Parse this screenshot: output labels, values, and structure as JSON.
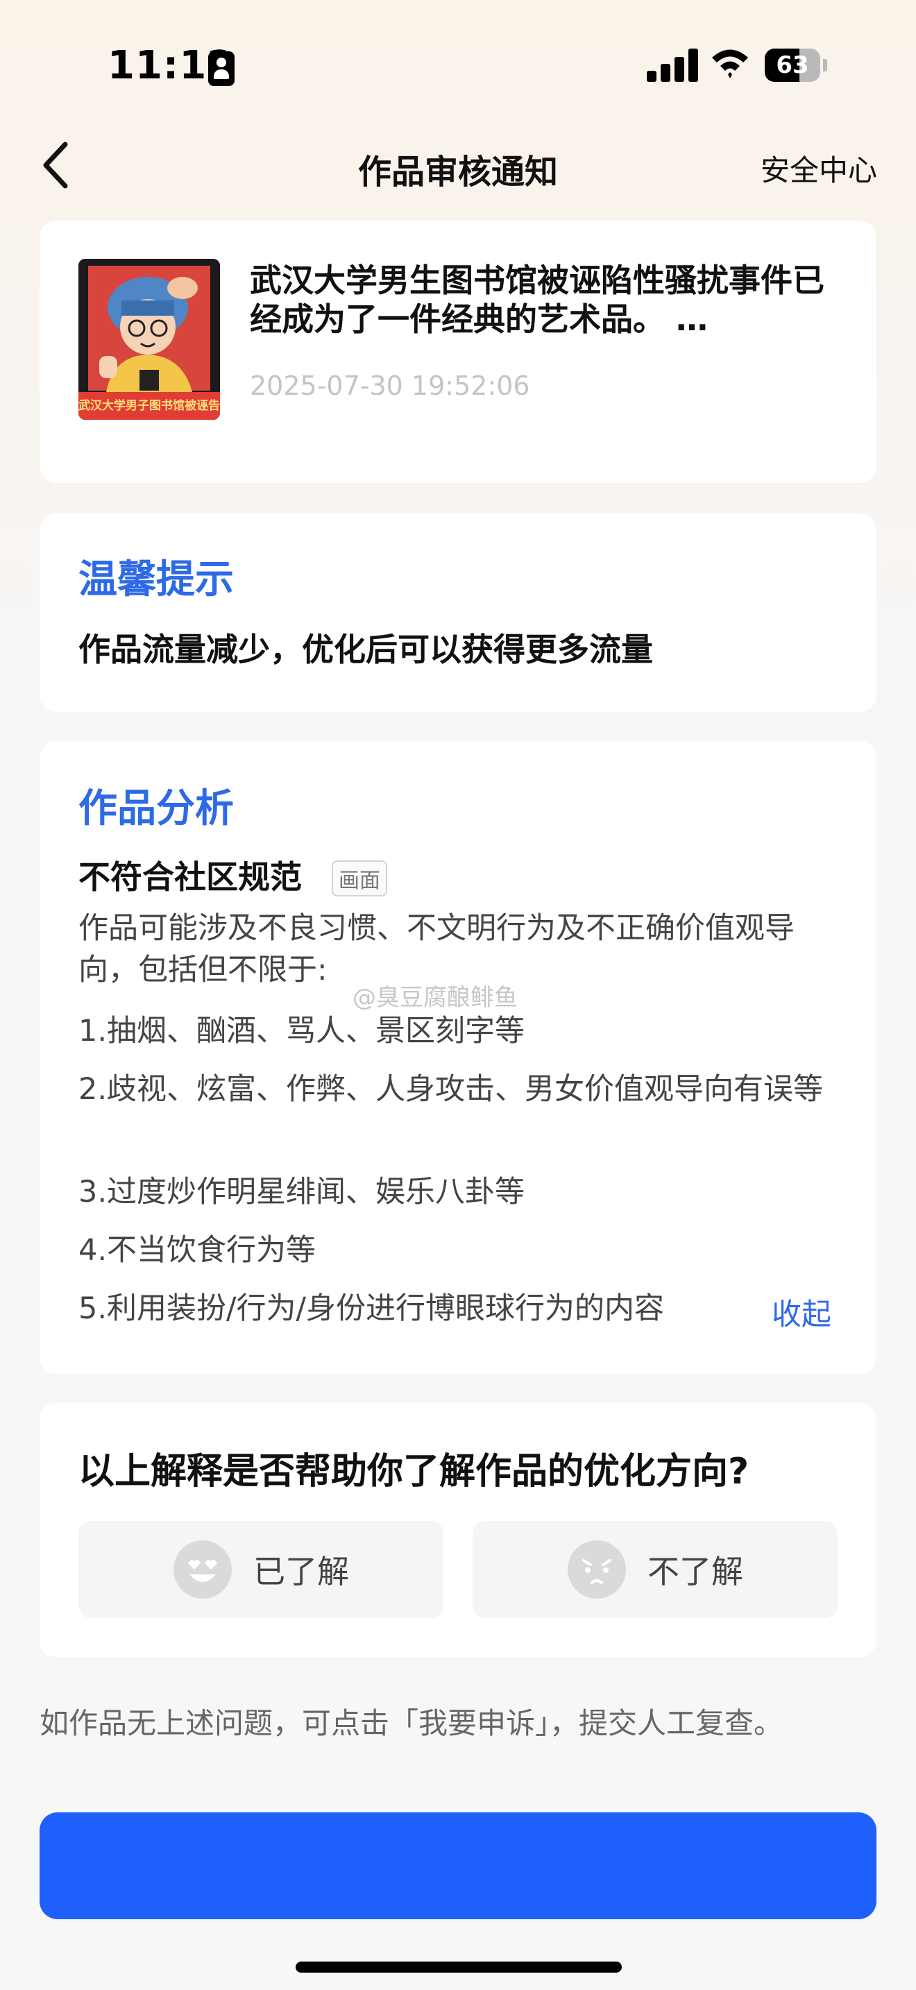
{
  "status_bar": {
    "time": "11:12",
    "battery": "63",
    "battery_level": 0.63
  },
  "nav": {
    "title": "作品审核通知",
    "right_link": "安全中心"
  },
  "post": {
    "title": "武汉大学男生图书馆被诬陷性骚扰事件已经成为了一件经典的艺术品。 …",
    "time": "2025-07-30 19:52:06",
    "thumb_caption": "武汉大学男子图书馆被诬告"
  },
  "tip": {
    "heading": "温馨提示",
    "text": "作品流量减少，优化后可以获得更多流量"
  },
  "analysis": {
    "heading": "作品分析",
    "rule_title": "不符合社区规范",
    "rule_tag": "画面",
    "intro": "作品可能涉及不良习惯、不文明行为及不正确价值观导向，包括但不限于:",
    "items": [
      "1.抽烟、酗酒、骂人、景区刻字等",
      "2.歧视、炫富、作弊、人身攻击、男女价值观导向有误等",
      "3.过度炒作明星绯闻、娱乐八卦等",
      "4.不当饮食行为等",
      "5.利用装扮/行为/身份进行博眼球行为的内容"
    ],
    "collapse_label": "收起",
    "watermark": "@臭豆腐酿鲱鱼"
  },
  "feedback": {
    "question": "以上解释是否帮助你了解作品的优化方向?",
    "yes_label": "已了解",
    "no_label": "不了解"
  },
  "appeal": {
    "note": "如作品无上述问题，可点击「我要申诉」，提交人工复查。",
    "button_label": ""
  },
  "colors": {
    "accent": "#2e6ae6",
    "primary_button": "#1f5ffb"
  }
}
